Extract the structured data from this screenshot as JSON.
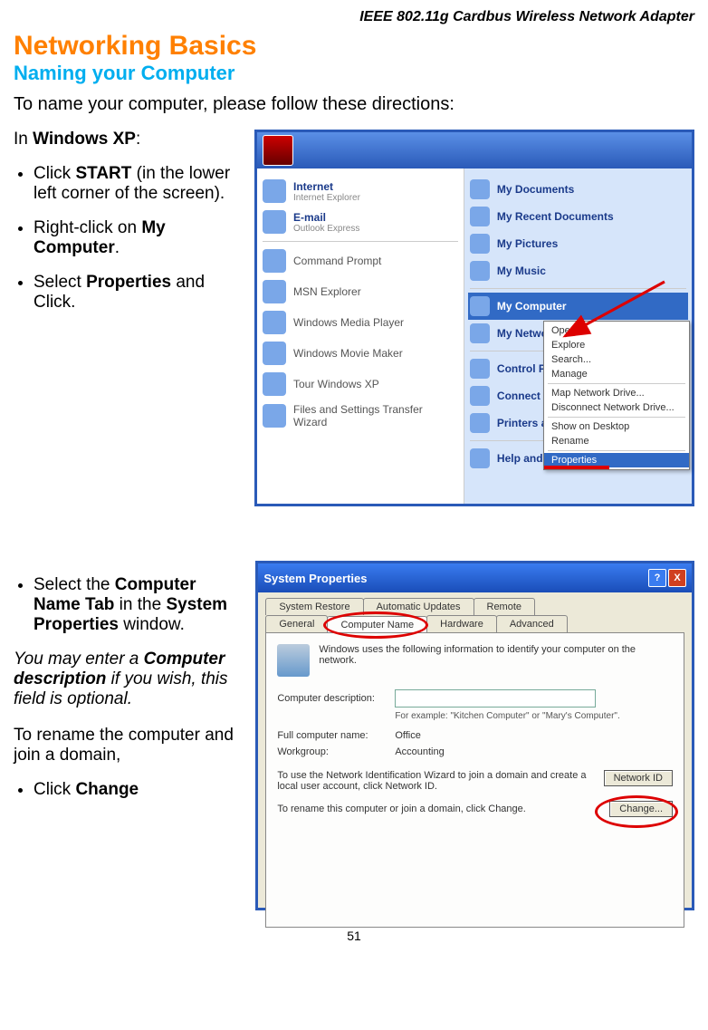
{
  "header_product": "IEEE 802.11g Cardbus Wireless Network Adapter",
  "h1": "Networking Basics",
  "h2": "Naming your Computer",
  "intro": "To name your computer, please follow these directions:",
  "section1": {
    "lead_plain": "In ",
    "lead_bold": "Windows XP",
    "lead_end": ":",
    "bullets": [
      {
        "pre": "Click ",
        "b": "START",
        "post": " (in the lower left corner of the screen)."
      },
      {
        "pre": "Right-click on ",
        "b": "My Computer",
        "post": "."
      },
      {
        "pre": "Select ",
        "b": "Properties",
        "post": " and Click."
      }
    ]
  },
  "section2": {
    "bullet": {
      "pre": "Select the ",
      "b": "Computer Name Tab",
      "mid": " in the ",
      "b2": "System Properties",
      "post": " window."
    },
    "hint_plain": "You may enter a ",
    "hint_bold": "Computer description",
    "hint_end": " if you wish, this field is optional.",
    "rename_lead": "To rename the computer and join a domain,",
    "rename_bullet_pre": "Click ",
    "rename_bullet_b": "Change"
  },
  "startmenu": {
    "left_pinned": [
      {
        "t": "Internet",
        "s": "Internet Explorer"
      },
      {
        "t": "E-mail",
        "s": "Outlook Express"
      }
    ],
    "left_items": [
      "Command Prompt",
      "MSN Explorer",
      "Windows Media Player",
      "Windows Movie Maker",
      "Tour Windows XP",
      "Files and Settings Transfer Wizard"
    ],
    "right_items": [
      "My Documents",
      "My Recent Documents",
      "My Pictures",
      "My Music",
      "My Computer",
      "My Network Places",
      "Control Panel",
      "Connect To",
      "Printers and Faxes",
      "Help and Support"
    ],
    "selected_right": "My Computer",
    "context": [
      "Open",
      "Explore",
      "Search...",
      "Manage",
      "Map Network Drive...",
      "Disconnect Network Drive...",
      "Show on Desktop",
      "Rename",
      "Properties"
    ],
    "context_selected": "Properties"
  },
  "sysprop": {
    "title": "System Properties",
    "tabs_row1": [
      "System Restore",
      "Automatic Updates",
      "Remote"
    ],
    "tabs_row2": [
      "General",
      "Computer Name",
      "Hardware",
      "Advanced"
    ],
    "active_tab": "Computer Name",
    "info": "Windows uses the following information to identify your computer on the network.",
    "desc_label": "Computer description:",
    "desc_hint": "For example: \"Kitchen Computer\" or \"Mary's Computer\".",
    "full_label": "Full computer name:",
    "full_value": "Office",
    "wg_label": "Workgroup:",
    "wg_value": "Accounting",
    "netid_text": "To use the Network Identification Wizard to join a domain and create a local user account, click Network ID.",
    "netid_btn": "Network ID",
    "change_text": "To rename this computer or join a domain, click Change.",
    "change_btn": "Change..."
  },
  "page_number": "51"
}
